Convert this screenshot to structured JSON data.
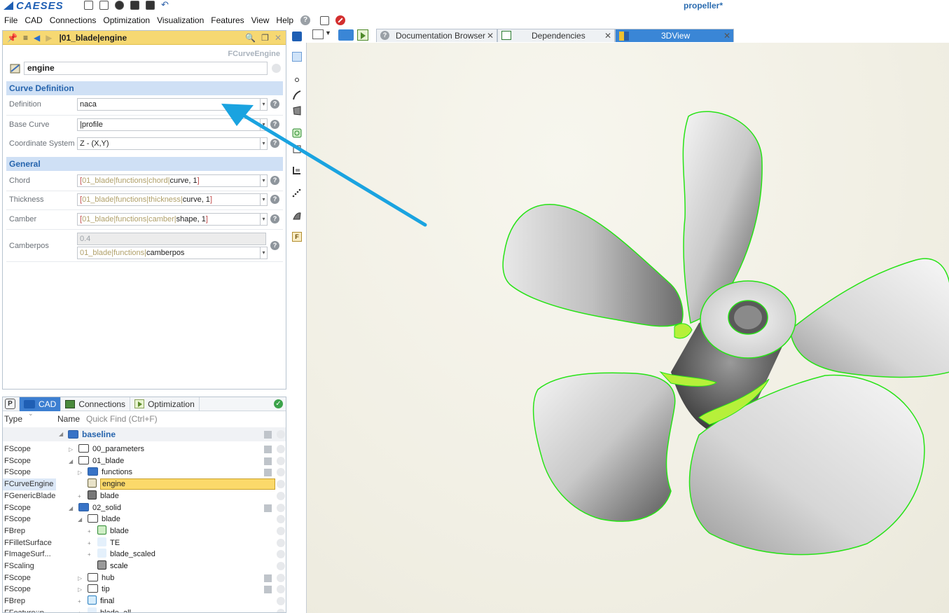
{
  "app": {
    "logo_text": "CAESES",
    "document_title": "propeller*"
  },
  "menubar": {
    "items": [
      "File",
      "CAD",
      "Connections",
      "Optimization",
      "Visualization",
      "Features",
      "View",
      "Help"
    ]
  },
  "property_panel": {
    "header_title": "|01_blade|engine",
    "type_label": "FCurveEngine",
    "name_value": "engine",
    "sections": {
      "curve_definition": "Curve Definition",
      "general": "General"
    },
    "rows": {
      "definition": {
        "label": "Definition",
        "value": "naca"
      },
      "base_curve": {
        "label": "Base Curve",
        "value": "|profile"
      },
      "coordinate_system": {
        "label": "Coordinate System",
        "value": "Z - (X,Y)"
      },
      "chord": {
        "label": "Chord",
        "open": "[",
        "ref": "01_blade|functions|chord|",
        "val": "curve, 1",
        "close": "]"
      },
      "thickness": {
        "label": "Thickness",
        "open": "[",
        "ref": "01_blade|functions|thickness|",
        "val": "curve, 1",
        "close": "]"
      },
      "camber": {
        "label": "Camber",
        "open": "[",
        "ref": "01_blade|functions|camber|",
        "val": "shape, 1",
        "close": "]"
      },
      "camberpos": {
        "label": "Camberpos",
        "value": "0.4",
        "ref": "01_blade|functions|",
        "val": "camberpos"
      }
    }
  },
  "tree_panel": {
    "tabs": {
      "p": "P",
      "cad": "CAD",
      "connections": "Connections",
      "optimization": "Optimization"
    },
    "columns": {
      "type": "Type",
      "name": "Name",
      "quick_find": "Quick Find (Ctrl+F)"
    },
    "root": "baseline",
    "rows": [
      {
        "type": "FScope",
        "name": "00_parameters"
      },
      {
        "type": "FScope",
        "name": "01_blade"
      },
      {
        "type": "FScope",
        "name": "functions"
      },
      {
        "type": "FCurveEngine",
        "name": "engine"
      },
      {
        "type": "FGenericBlade",
        "name": "blade"
      },
      {
        "type": "FScope",
        "name": "02_solid"
      },
      {
        "type": "FScope",
        "name": "blade"
      },
      {
        "type": "FBrep",
        "name": "blade"
      },
      {
        "type": "FFilletSurface",
        "name": "TE"
      },
      {
        "type": "FImageSurf...",
        "name": "blade_scaled"
      },
      {
        "type": "FScaling",
        "name": "scale"
      },
      {
        "type": "FScope",
        "name": "hub"
      },
      {
        "type": "FScope",
        "name": "tip"
      },
      {
        "type": "FBrep",
        "name": "final"
      },
      {
        "type": "FFeature::p...",
        "name": "blade_all"
      }
    ]
  },
  "doc_tabs": {
    "documentation": "Documentation Browser",
    "dependencies": "Dependencies",
    "view3d": "3DView"
  },
  "colors": {
    "header_yellow": "#f6d872",
    "section_blue": "#cfe0f5",
    "accent_blue": "#2664ad",
    "annotation_arrow": "#1aa3e0",
    "edge_green": "#27e316"
  }
}
